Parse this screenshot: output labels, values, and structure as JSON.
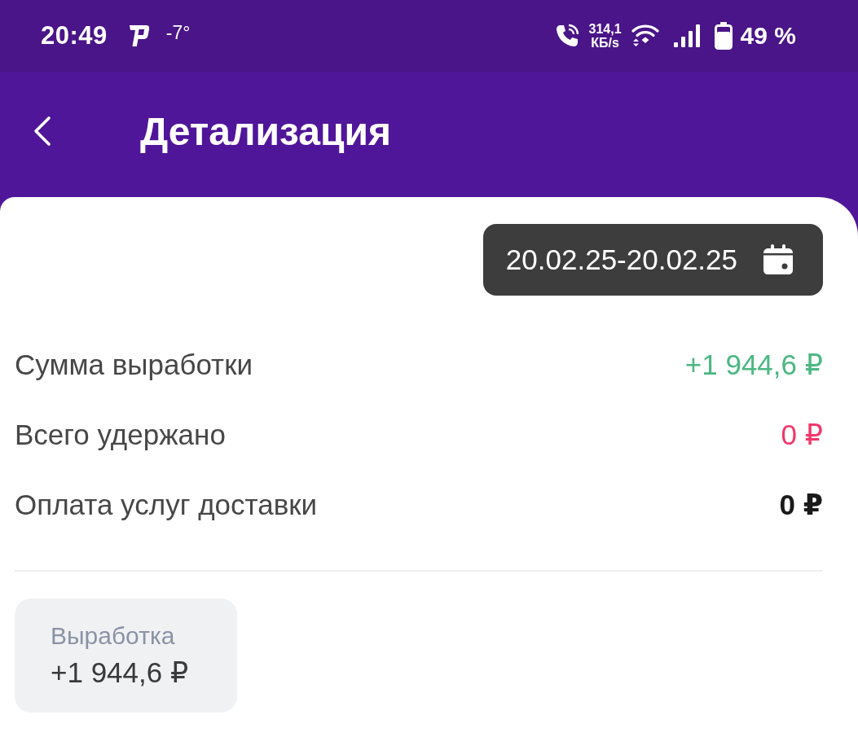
{
  "status_bar": {
    "time": "20:49",
    "temperature": "-7°",
    "network_speed": [
      "314,1",
      "КБ/s"
    ],
    "battery": "49 %"
  },
  "header": {
    "title": "Детализация"
  },
  "date_range": {
    "label": "20.02.25-20.02.25"
  },
  "summary_rows": [
    {
      "label": "Сумма выработки",
      "value": "+1 944,6 ₽",
      "color": "#4cb782",
      "bold": false
    },
    {
      "label": "Всего удержано",
      "value": "0 ₽",
      "color": "#f0386b",
      "bold": false
    },
    {
      "label": "Оплата услуг доставки",
      "value": "0 ₽",
      "color": "#1a1a1a",
      "bold": true
    }
  ],
  "cards": [
    {
      "label": "Выработка",
      "value": "+1 944,6 ₽"
    }
  ]
}
